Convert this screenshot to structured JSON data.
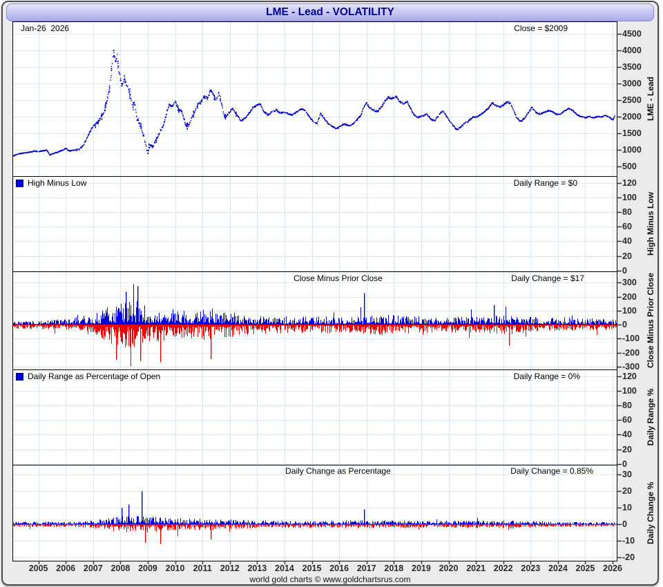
{
  "title": "LME - Lead - VOLATILITY",
  "footer_credit": "world gold charts © www.goldchartsrus.com",
  "colors": {
    "price_line": "#0000cc",
    "bar_up": "#0000dd",
    "bar_down": "#ee0000",
    "gridline": "#d7e7f6",
    "panel_bg": "#ffffff",
    "panel_border": "#000000",
    "frame_bg": "#ebebeb",
    "title_text": "#000099",
    "tick_text": "#2a2a2a"
  },
  "x_axis": {
    "year_labels": [
      "2005",
      "2006",
      "2007",
      "2008",
      "2009",
      "2010",
      "2011",
      "2012",
      "2013",
      "2014",
      "2015",
      "2016",
      "2017",
      "2018",
      "2019",
      "2020",
      "2021",
      "2022",
      "2023",
      "2024",
      "2025",
      "2026"
    ]
  },
  "chart_data": {
    "type": "multi-panel-time-series",
    "x_domain": [
      2004.05,
      2026.15
    ],
    "panels": [
      {
        "id": "price",
        "type": "line",
        "line_style": "dotted",
        "axis_title": "LME - Lead",
        "date_label": "Jan-26  2026",
        "value_label": "Close = $2009",
        "ylim": [
          200,
          4880
        ],
        "yticks": [
          4500,
          4000,
          3500,
          3000,
          2500,
          2000,
          1500,
          1000,
          500
        ],
        "series_x": [
          2004.05,
          2004.25,
          2004.5,
          2004.7,
          2004.85,
          2005.0,
          2005.15,
          2005.3,
          2005.42,
          2005.55,
          2005.7,
          2005.85,
          2006.0,
          2006.12,
          2006.3,
          2006.5,
          2006.65,
          2006.8,
          2006.95,
          2007.1,
          2007.25,
          2007.4,
          2007.5,
          2007.6,
          2007.68,
          2007.75,
          2007.82,
          2007.88,
          2007.95,
          2008.05,
          2008.15,
          2008.25,
          2008.35,
          2008.45,
          2008.52,
          2008.6,
          2008.7,
          2008.8,
          2008.9,
          2009.0,
          2009.08,
          2009.18,
          2009.3,
          2009.45,
          2009.6,
          2009.7,
          2009.8,
          2009.9,
          2010.0,
          2010.1,
          2010.25,
          2010.4,
          2010.5,
          2010.65,
          2010.8,
          2010.95,
          2011.05,
          2011.2,
          2011.3,
          2011.4,
          2011.5,
          2011.6,
          2011.7,
          2011.8,
          2011.9,
          2012.0,
          2012.1,
          2012.25,
          2012.4,
          2012.55,
          2012.7,
          2012.85,
          2013.0,
          2013.1,
          2013.25,
          2013.4,
          2013.55,
          2013.7,
          2013.85,
          2014.0,
          2014.15,
          2014.3,
          2014.45,
          2014.6,
          2014.75,
          2014.9,
          2015.05,
          2015.2,
          2015.32,
          2015.45,
          2015.6,
          2015.75,
          2015.9,
          2016.05,
          2016.2,
          2016.35,
          2016.5,
          2016.65,
          2016.8,
          2016.9,
          2017.0,
          2017.1,
          2017.25,
          2017.4,
          2017.55,
          2017.7,
          2017.8,
          2017.95,
          2018.1,
          2018.2,
          2018.35,
          2018.5,
          2018.6,
          2018.75,
          2018.9,
          2019.05,
          2019.2,
          2019.35,
          2019.5,
          2019.65,
          2019.8,
          2019.9,
          2020.0,
          2020.15,
          2020.3,
          2020.45,
          2020.6,
          2020.75,
          2020.9,
          2021.0,
          2021.15,
          2021.3,
          2021.45,
          2021.6,
          2021.7,
          2021.85,
          2022.0,
          2022.15,
          2022.25,
          2022.4,
          2022.5,
          2022.65,
          2022.8,
          2022.95,
          2023.05,
          2023.2,
          2023.35,
          2023.5,
          2023.65,
          2023.8,
          2023.95,
          2024.1,
          2024.25,
          2024.4,
          2024.55,
          2024.7,
          2024.85,
          2025.0,
          2025.15,
          2025.3,
          2025.45,
          2025.6,
          2025.75,
          2025.9,
          2026.0,
          2026.08
        ],
        "series_y": [
          800,
          870,
          900,
          930,
          955,
          945,
          965,
          985,
          840,
          890,
          920,
          975,
          1040,
          965,
          985,
          1010,
          1150,
          1400,
          1650,
          1780,
          1930,
          2150,
          2450,
          2850,
          3450,
          3980,
          3650,
          3850,
          3350,
          2950,
          3150,
          2900,
          2700,
          2300,
          2400,
          1950,
          1800,
          1550,
          1250,
          900,
          1150,
          1080,
          1300,
          1550,
          1800,
          2150,
          2380,
          2300,
          2480,
          2250,
          2150,
          1700,
          1750,
          2050,
          2350,
          2420,
          2600,
          2550,
          2820,
          2650,
          2480,
          2700,
          2400,
          1980,
          2050,
          2150,
          2250,
          2050,
          1880,
          1950,
          2100,
          2280,
          2350,
          2400,
          2150,
          2050,
          2150,
          2200,
          2100,
          2150,
          2080,
          2050,
          2150,
          2220,
          2200,
          2000,
          1850,
          1800,
          2100,
          1950,
          1780,
          1700,
          1620,
          1730,
          1780,
          1720,
          1780,
          1900,
          2050,
          2300,
          2400,
          2280,
          2200,
          2150,
          2300,
          2500,
          2580,
          2550,
          2600,
          2450,
          2400,
          2450,
          2250,
          2050,
          1980,
          2020,
          2080,
          1920,
          1880,
          2050,
          2180,
          2050,
          1920,
          1750,
          1600,
          1700,
          1800,
          1880,
          2000,
          1980,
          2050,
          2150,
          2250,
          2420,
          2350,
          2280,
          2350,
          2450,
          2400,
          2150,
          1950,
          1850,
          1980,
          2150,
          2280,
          2120,
          2080,
          2130,
          2180,
          2150,
          2060,
          2080,
          2180,
          2250,
          2180,
          2060,
          2000,
          1960,
          2010,
          1960,
          2000,
          1990,
          2040,
          1970,
          1900,
          2009
        ]
      },
      {
        "id": "high-minus-low",
        "type": "bar",
        "legend": "High Minus Low",
        "value_label": "Daily Range = $0",
        "axis_title": "High Minus Low",
        "ylim": [
          -1,
          129
        ],
        "yticks": [
          120,
          100,
          80,
          60,
          40,
          20,
          0
        ],
        "series": "no visible data (all zero)"
      },
      {
        "id": "close-minus-prior-close",
        "type": "bar",
        "title": "Close Minus Prior Close",
        "value_label": "Daily Change = $17",
        "axis_title": "Close Minus Prior Close",
        "ylim": [
          -320,
          380
        ],
        "yticks": [
          300,
          200,
          100,
          0,
          -100,
          -200,
          -300
        ],
        "envelope_x": [
          2004.05,
          2005.5,
          2006.3,
          2006.9,
          2007.3,
          2007.7,
          2008.1,
          2008.6,
          2009.0,
          2009.6,
          2010.3,
          2010.9,
          2011.4,
          2011.9,
          2012.5,
          2013.5,
          2014.5,
          2015.5,
          2016.3,
          2017.0,
          2017.8,
          2018.5,
          2019.5,
          2020.3,
          2021.0,
          2021.8,
          2022.3,
          2022.9,
          2023.5,
          2024.3,
          2025.2,
          2026.1
        ],
        "envelope_y": [
          22,
          25,
          35,
          55,
          75,
          105,
          120,
          125,
          90,
          85,
          75,
          80,
          85,
          70,
          55,
          48,
          42,
          45,
          42,
          52,
          55,
          50,
          38,
          45,
          42,
          52,
          55,
          45,
          35,
          35,
          30,
          30
        ],
        "spikes": [
          {
            "x": 2007.85,
            "v": -250
          },
          {
            "x": 2008.2,
            "v": 235
          },
          {
            "x": 2008.62,
            "v": 275
          },
          {
            "x": 2008.72,
            "v": -260
          },
          {
            "x": 2009.45,
            "v": -268
          },
          {
            "x": 2011.3,
            "v": -245
          },
          {
            "x": 2016.9,
            "v": 225
          },
          {
            "x": 2021.65,
            "v": 140
          },
          {
            "x": 2022.2,
            "v": -150
          }
        ]
      },
      {
        "id": "daily-range-pct",
        "type": "bar",
        "legend": "Daily Range as Percentage of Open",
        "value_label": "Daily Range = 0%",
        "axis_title": "Daily Range %",
        "ylim": [
          -1,
          129
        ],
        "yticks": [
          120,
          100,
          80,
          60,
          40,
          20,
          0
        ],
        "series": "no visible data (all zero)"
      },
      {
        "id": "daily-change-pct",
        "type": "bar",
        "title": "Daily Change as Percentage",
        "value_label": "Daily Change = 0.85%",
        "axis_title": "Daily Change %",
        "ylim": [
          -22,
          36
        ],
        "yticks": [
          30,
          20,
          10,
          0,
          -10,
          -20
        ],
        "envelope_x": [
          2004.05,
          2006.5,
          2007.3,
          2007.8,
          2008.5,
          2008.9,
          2009.6,
          2010.5,
          2011.5,
          2012.5,
          2014.0,
          2015.5,
          2017.0,
          2018.5,
          2019.5,
          2020.3,
          2021.5,
          2022.3,
          2023.5,
          2025.0,
          2026.1
        ],
        "envelope_y": [
          1.2,
          1.3,
          2.2,
          3.2,
          3.8,
          4.2,
          3.2,
          2.6,
          2.6,
          1.9,
          1.6,
          1.7,
          1.8,
          1.7,
          1.4,
          1.9,
          1.6,
          1.9,
          1.2,
          1.1,
          1.1
        ],
        "spikes": [
          {
            "x": 2008.05,
            "v": 10
          },
          {
            "x": 2008.3,
            "v": 12
          },
          {
            "x": 2008.78,
            "v": 20
          },
          {
            "x": 2008.9,
            "v": -11
          },
          {
            "x": 2009.45,
            "v": -12
          },
          {
            "x": 2011.3,
            "v": -9
          },
          {
            "x": 2016.9,
            "v": 9
          }
        ]
      }
    ]
  }
}
